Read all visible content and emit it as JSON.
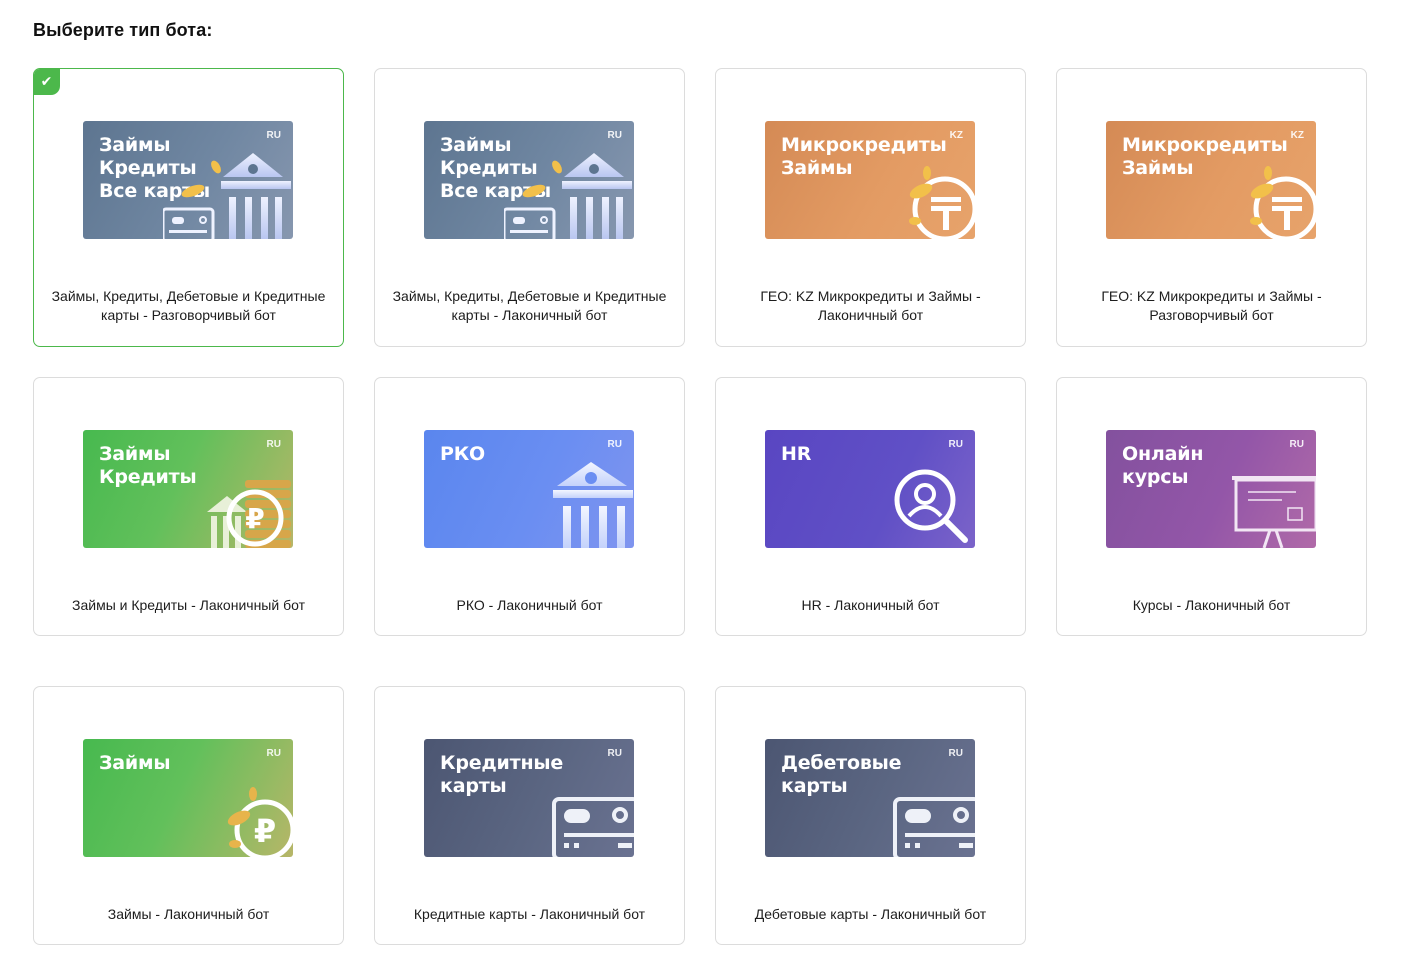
{
  "heading": "Выберите тип бота:",
  "cards": [
    {
      "title": "Займы\nКредиты\nВсе карты",
      "geo": "RU",
      "caption": "Займы, Кредиты, Дебетовые и Кредитные карты - Разговорчивый бот",
      "selected": true
    },
    {
      "title": "Займы\nКредиты\nВсе карты",
      "geo": "RU",
      "caption": "Займы, Кредиты, Дебетовые и Кредитные карты - Лаконичный бот"
    },
    {
      "title": "Микрокредиты\nЗаймы",
      "geo": "KZ",
      "caption": "ГЕО: KZ Микрокредиты и Займы - Лаконичный бот"
    },
    {
      "title": "Микрокредиты\nЗаймы",
      "geo": "KZ",
      "caption": "ГЕО: KZ Микрокредиты и Займы - Разговорчивый бот"
    },
    {
      "title": "Займы\nКредиты",
      "geo": "RU",
      "caption": "Займы и Кредиты - Лаконичный бот"
    },
    {
      "title": "РКО",
      "geo": "RU",
      "caption": "РКО - Лаконичный бот"
    },
    {
      "title": "HR",
      "geo": "RU",
      "caption": "HR - Лаконичный бот"
    },
    {
      "title": "Онлайн\nкурсы",
      "geo": "RU",
      "caption": "Курсы - Лаконичный бот"
    },
    {
      "title": "Займы",
      "geo": "RU",
      "caption": "Займы - Лаконичный бот"
    },
    {
      "title": "Кредитные\nкарты",
      "geo": "RU",
      "caption": "Кредитные карты - Лаконичный бот"
    },
    {
      "title": "Дебетовые\nкарты",
      "geo": "RU",
      "caption": "Дебетовые карты - Лаконичный бот"
    }
  ],
  "icons": {
    "selected_check": "check-icon",
    "card_0": "bank-coins-card-icon",
    "card_1": "bank-coins-card-icon",
    "card_2": "tenge-coin-icon",
    "card_3": "tenge-coin-icon",
    "card_4": "ruble-coin-stack-icon",
    "card_5": "bank-icon",
    "card_6": "magnifier-person-icon",
    "card_7": "presentation-board-icon",
    "card_8": "ruble-coin-icon",
    "card_9": "credit-card-icon",
    "card_10": "credit-card-icon"
  },
  "colors": {
    "selected_border": "#4cb84b",
    "card_border": "#dcdcdc"
  }
}
